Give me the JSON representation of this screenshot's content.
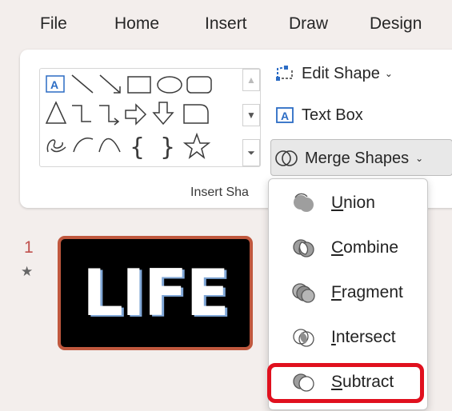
{
  "tabs": [
    "File",
    "Home",
    "Insert",
    "Draw",
    "Design"
  ],
  "ribbon": {
    "edit_shape": "Edit Shape",
    "text_box": "Text Box",
    "merge_shapes": "Merge Shapes",
    "group_label": "Insert Sha",
    "gallery_icons": [
      "text-box-icon",
      "line-icon",
      "arrow-line-icon",
      "rectangle-icon",
      "oval-icon",
      "rounded-rectangle-icon",
      "triangle-icon",
      "elbow-connector-icon",
      "elbow-arrow-connector-icon",
      "right-arrow-icon",
      "down-arrow-icon",
      "flowchart-icon",
      "freeform-scribble-icon",
      "arc-icon",
      "curve-icon",
      "left-brace-icon",
      "right-brace-icon",
      "star-icon"
    ]
  },
  "menu": {
    "items": [
      {
        "label": "Union",
        "accel": "U",
        "rest": "nion"
      },
      {
        "label": "Combine",
        "accel": "C",
        "rest": "ombine"
      },
      {
        "label": "Fragment",
        "accel": "F",
        "rest": "ragment"
      },
      {
        "label": "Intersect",
        "accel": "I",
        "rest": "ntersect"
      },
      {
        "label": "Subtract",
        "accel": "S",
        "rest": "ubtract"
      }
    ],
    "highlighted": "Subtract"
  },
  "slide": {
    "number": "1",
    "star": "★",
    "text": "LIFE"
  },
  "colors": {
    "highlight": "#e0101e",
    "slide_border": "#c0583e",
    "accent_blue": "#2b6cc4"
  }
}
